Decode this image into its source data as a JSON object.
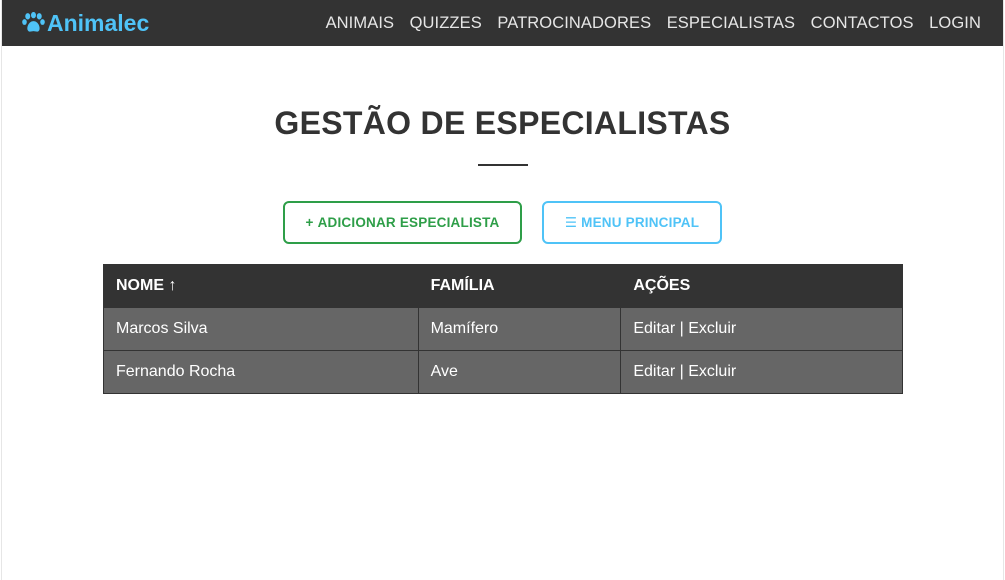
{
  "navbar": {
    "brand": "Animalec",
    "brand_icon": "paw-icon",
    "links": [
      "ANIMAIS",
      "QUIZZES",
      "PATROCINADORES",
      "ESPECIALISTAS",
      "CONTACTOS",
      "LOGIN"
    ]
  },
  "page": {
    "title": "GESTÃO DE ESPECIALISTAS"
  },
  "actions": {
    "add_label": "ADICIONAR ESPECIALISTA",
    "add_icon": "+",
    "menu_label": "MENU PRINCIPAL",
    "menu_icon": "☰"
  },
  "table": {
    "headers": {
      "name": "NOME ↑",
      "family": "FAMÍLIA",
      "actions": "AÇÕES"
    },
    "rows": [
      {
        "name": "Marcos Silva",
        "family": "Mamífero",
        "edit": "Editar",
        "sep": " | ",
        "delete": "Excluir"
      },
      {
        "name": "Fernando Rocha",
        "family": "Ave",
        "edit": "Editar",
        "sep": " | ",
        "delete": "Excluir"
      }
    ]
  },
  "colors": {
    "navbar_bg": "#333333",
    "brand": "#4fc3f7",
    "add_button": "#2e9e48",
    "menu_button": "#4fc3f7",
    "table_header_bg": "#333333",
    "table_row_bg": "#666666"
  }
}
